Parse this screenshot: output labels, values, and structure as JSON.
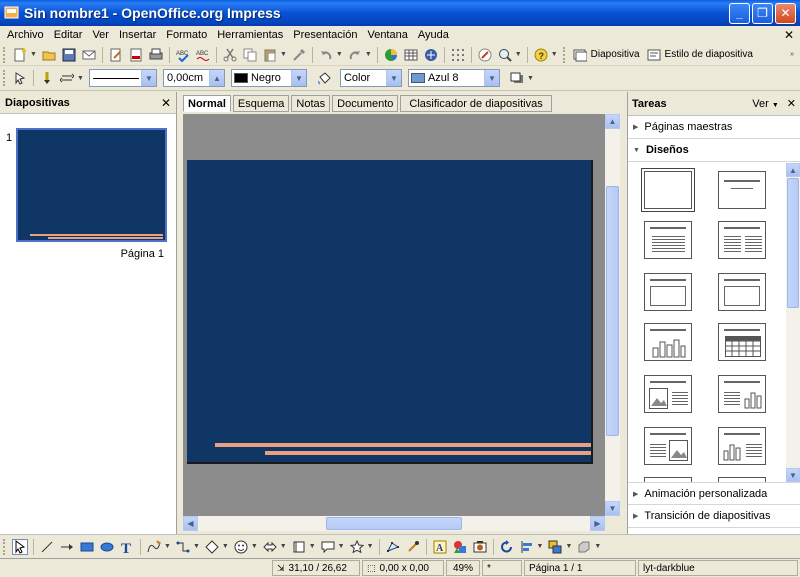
{
  "window": {
    "title": "Sin nombre1 - OpenOffice.org Impress",
    "minimize": "_",
    "maximize": "❐",
    "close": "✕"
  },
  "menu": [
    "Archivo",
    "Editar",
    "Ver",
    "Insertar",
    "Formato",
    "Herramientas",
    "Presentación",
    "Ventana",
    "Ayuda"
  ],
  "menu_close": "✕",
  "toolbar1": {
    "slide_label": "Diapositiva",
    "slide_style_label": "Estilo de diapositiva"
  },
  "toolbar2": {
    "line_width": "0,00cm",
    "line_color": "Negro",
    "area_style": "Color",
    "area_color": "Azul 8"
  },
  "colors": {
    "slide_bg": "#0f3664",
    "accent_line": "#e8a080",
    "line_swatch": "#000000",
    "area_swatch": "#6b9ad6"
  },
  "slides_panel": {
    "title": "Diapositivas",
    "close": "✕",
    "slide_number": "1",
    "slide_label": "Página 1"
  },
  "view_tabs": [
    "Normal",
    "Esquema",
    "Notas",
    "Documento",
    "Clasificador de diapositivas"
  ],
  "active_tab": "Normal",
  "tasks": {
    "title": "Tareas",
    "view_label": "Ver",
    "close": "✕",
    "master_pages": "Páginas maestras",
    "layouts": "Diseños",
    "custom_animation": "Animación personalizada",
    "slide_transition": "Transición de diapositivas"
  },
  "status": {
    "position": "31,10 / 26,62",
    "size": "0,00 x 0,00",
    "zoom": "49%",
    "modified": "*",
    "page": "Página 1 / 1",
    "layout_name": "lyt-darkblue"
  }
}
